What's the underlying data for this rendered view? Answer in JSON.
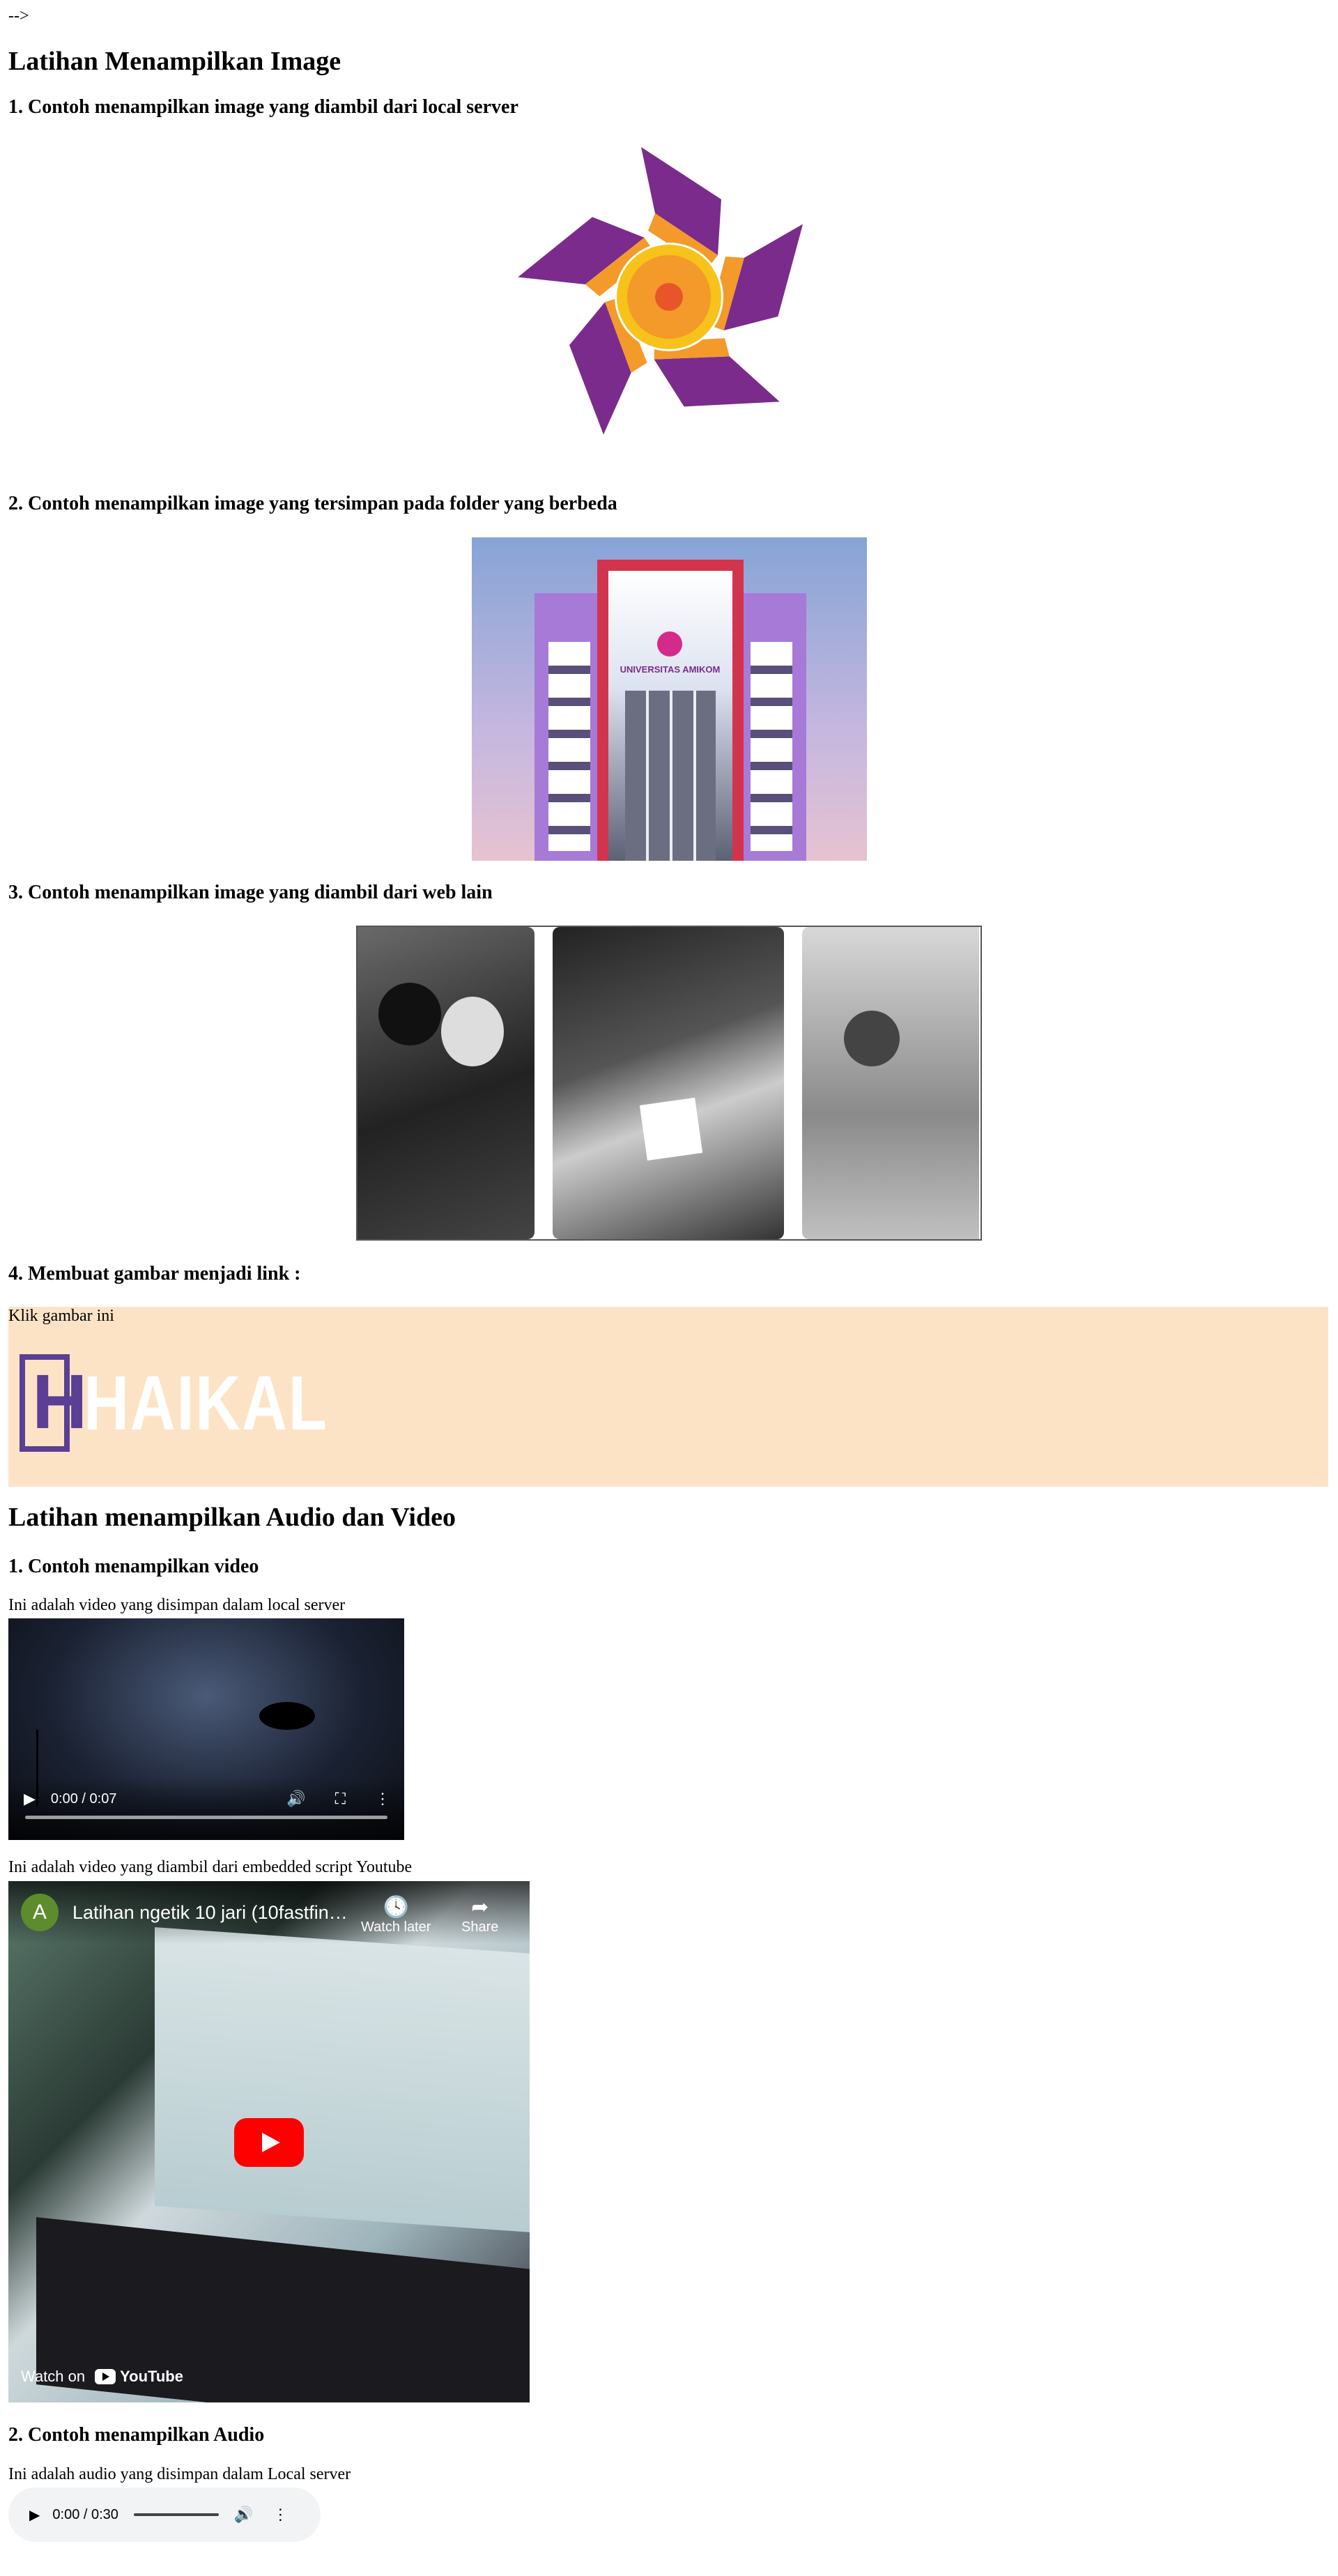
{
  "stray_text": "-->",
  "image_section": {
    "title": "Latihan Menampilkan Image",
    "h1": "1. Contoh menampilkan image yang diambil dari local server",
    "h2": "2. Contoh menampilkan image yang tersimpan pada folder yang berbeda",
    "h3": "3. Contoh menampilkan image yang diambil dari web lain",
    "h4": "4. Membuat gambar menjadi link :",
    "building_sign": "UNIVERSITAS AMIKOM",
    "link_label": "Klik gambar ini",
    "brand_letter": "H",
    "brand_word": "HAIKAL"
  },
  "media_section": {
    "title": "Latihan menampilkan Audio dan Video",
    "h1": "1. Contoh menampilkan video",
    "video_caption": "Ini adalah video yang disimpan dalam local server",
    "video_time": "0:00 / 0:07",
    "youtube_caption": "Ini adalah video yang diambil dari embedded script Youtube",
    "youtube": {
      "avatar_letter": "A",
      "title": "Latihan ngetik 10 jari (10fastfin…",
      "watch_later": "Watch later",
      "share": "Share",
      "watch_on": "Watch on",
      "brand": "YouTube"
    },
    "h2": "2. Contoh menampilkan Audio",
    "audio_caption": "Ini adalah audio yang disimpan dalam Local server",
    "audio_time": "0:00 / 0:30"
  },
  "colors": {
    "logo_purple": "#7b2b8c",
    "logo_orange": "#f39a2a",
    "logo_yellow": "#f7c21a",
    "link_bg": "#fde3c6",
    "brand_purple": "#5a3f94"
  }
}
